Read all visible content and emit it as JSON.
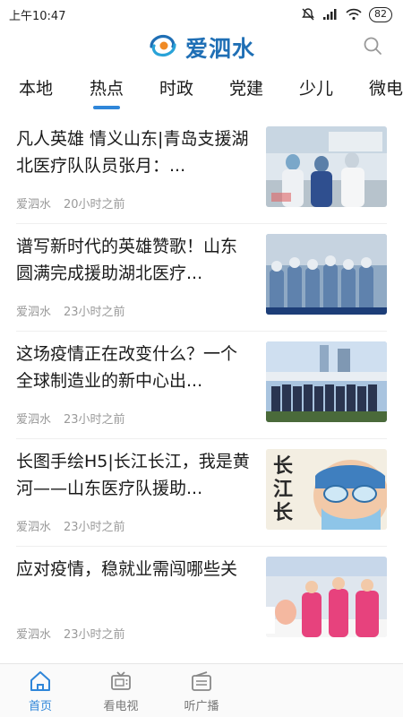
{
  "status_bar": {
    "time": "上午10:47",
    "battery": "82",
    "icons": [
      "mute-alarm-icon",
      "signal-icon",
      "wifi-icon",
      "battery-icon"
    ]
  },
  "header": {
    "app_name": "爱泗水",
    "logo_icon": "swirl-logo-icon",
    "search_icon": "search-icon"
  },
  "tabs": [
    {
      "label": "本地",
      "active": false
    },
    {
      "label": "热点",
      "active": true
    },
    {
      "label": "时政",
      "active": false
    },
    {
      "label": "党建",
      "active": false
    },
    {
      "label": "少儿",
      "active": false
    },
    {
      "label": "微电",
      "active": false
    }
  ],
  "news": [
    {
      "title": "凡人英雄 情义山东|青岛支援湖北医疗队队员张月：...",
      "source": "爱泗水",
      "time": "20小时之前"
    },
    {
      "title": "谱写新时代的英雄赞歌！山东圆满完成援助湖北医疗...",
      "source": "爱泗水",
      "time": "23小时之前"
    },
    {
      "title": "这场疫情正在改变什么？一个全球制造业的新中心出...",
      "source": "爱泗水",
      "time": "23小时之前"
    },
    {
      "title": "长图手绘H5|长江长江，我是黄河——山东医疗队援助...",
      "source": "爱泗水",
      "time": "23小时之前"
    },
    {
      "title": "应对疫情，稳就业需闯哪些关",
      "source": "爱泗水",
      "time": "23小时之前"
    }
  ],
  "thumb_texts": {
    "t4_calligraphy": "长江长"
  },
  "bottom_nav": [
    {
      "label": "首页",
      "icon": "home-icon",
      "active": true
    },
    {
      "label": "看电视",
      "icon": "tv-icon",
      "active": false
    },
    {
      "label": "听广播",
      "icon": "radio-icon",
      "active": false
    }
  ],
  "colors": {
    "accent": "#2f86d9",
    "logo_blue": "#1f6fb5",
    "meta_gray": "#9a9a9a"
  }
}
